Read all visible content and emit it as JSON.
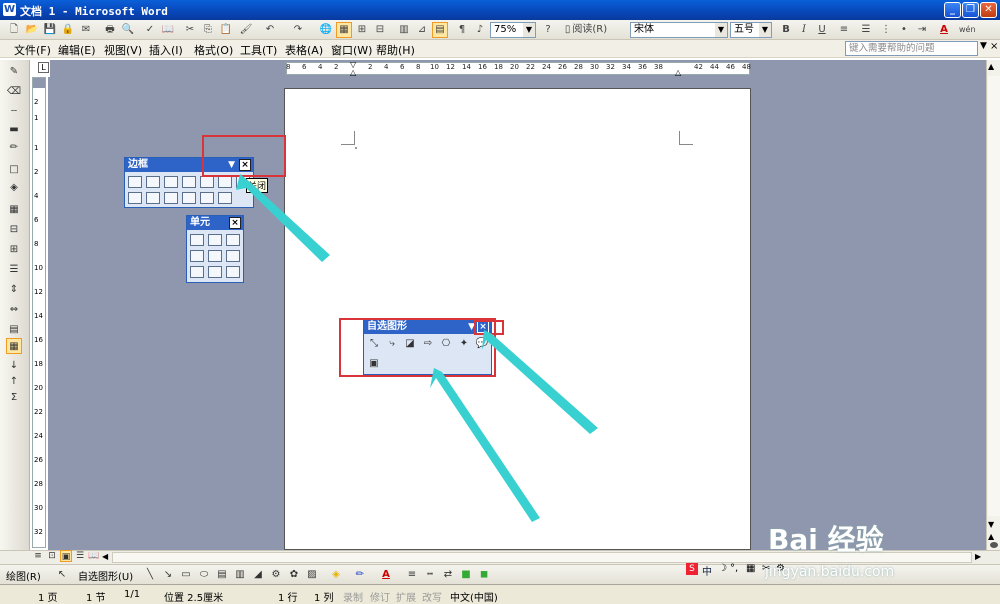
{
  "window": {
    "title": "文档 1 - Microsoft Word"
  },
  "toolbar": {
    "zoom": "75%",
    "read_label": "阅读(R)",
    "font": "宋体",
    "font_size": "五号",
    "bold": "B",
    "italic": "I",
    "underline": "U",
    "font_color_letter": "A",
    "wen_label": "wén"
  },
  "menubar": {
    "items": [
      "文件(F)",
      "编辑(E)",
      "视图(V)",
      "插入(I)",
      "格式(O)",
      "工具(T)",
      "表格(A)",
      "窗口(W)",
      "帮助(H)"
    ],
    "help_placeholder": "键入需要帮助的问题"
  },
  "ruler": {
    "ticks": [
      "8",
      "6",
      "4",
      "2",
      "2",
      "4",
      "6",
      "8",
      "10",
      "12",
      "14",
      "16",
      "18",
      "20",
      "22",
      "24",
      "26",
      "28",
      "30",
      "32",
      "34",
      "36",
      "38",
      "42",
      "44",
      "46",
      "48"
    ]
  },
  "vruler": {
    "ticks": [
      "2",
      "1",
      "1",
      "2",
      "4",
      "6",
      "8",
      "10",
      "12",
      "14",
      "16",
      "18",
      "20",
      "22",
      "24",
      "26",
      "28",
      "30",
      "32"
    ]
  },
  "borders_toolbar": {
    "title": "边框",
    "close": "×"
  },
  "tooltip": {
    "text": "关闭"
  },
  "cell_toolbar": {
    "title": "单元",
    "close": "×"
  },
  "autoshape_toolbar": {
    "title": "自选图形",
    "close": "×"
  },
  "drawbar": {
    "draw_label": "绘图(R)",
    "autoshapes_label": "自选图形(U)",
    "font_color_letter": "A"
  },
  "statusbar": {
    "page": "1 页",
    "section": "1 节",
    "pages": "1/1",
    "position": "位置 2.5厘米",
    "line": "1 行",
    "col": "1 列",
    "rec": "录制",
    "trk": "修订",
    "ext": "扩展",
    "ovr": "改写",
    "lang": "中文(中国)"
  },
  "watermark": {
    "brand": "Bai 经验",
    "url": "jingyan.baidu.com"
  },
  "colors": {
    "title_bar": "#0846b8",
    "canvas": "#8e97ad",
    "highlight_box": "#d8343a",
    "arrow": "#38d0d0"
  }
}
